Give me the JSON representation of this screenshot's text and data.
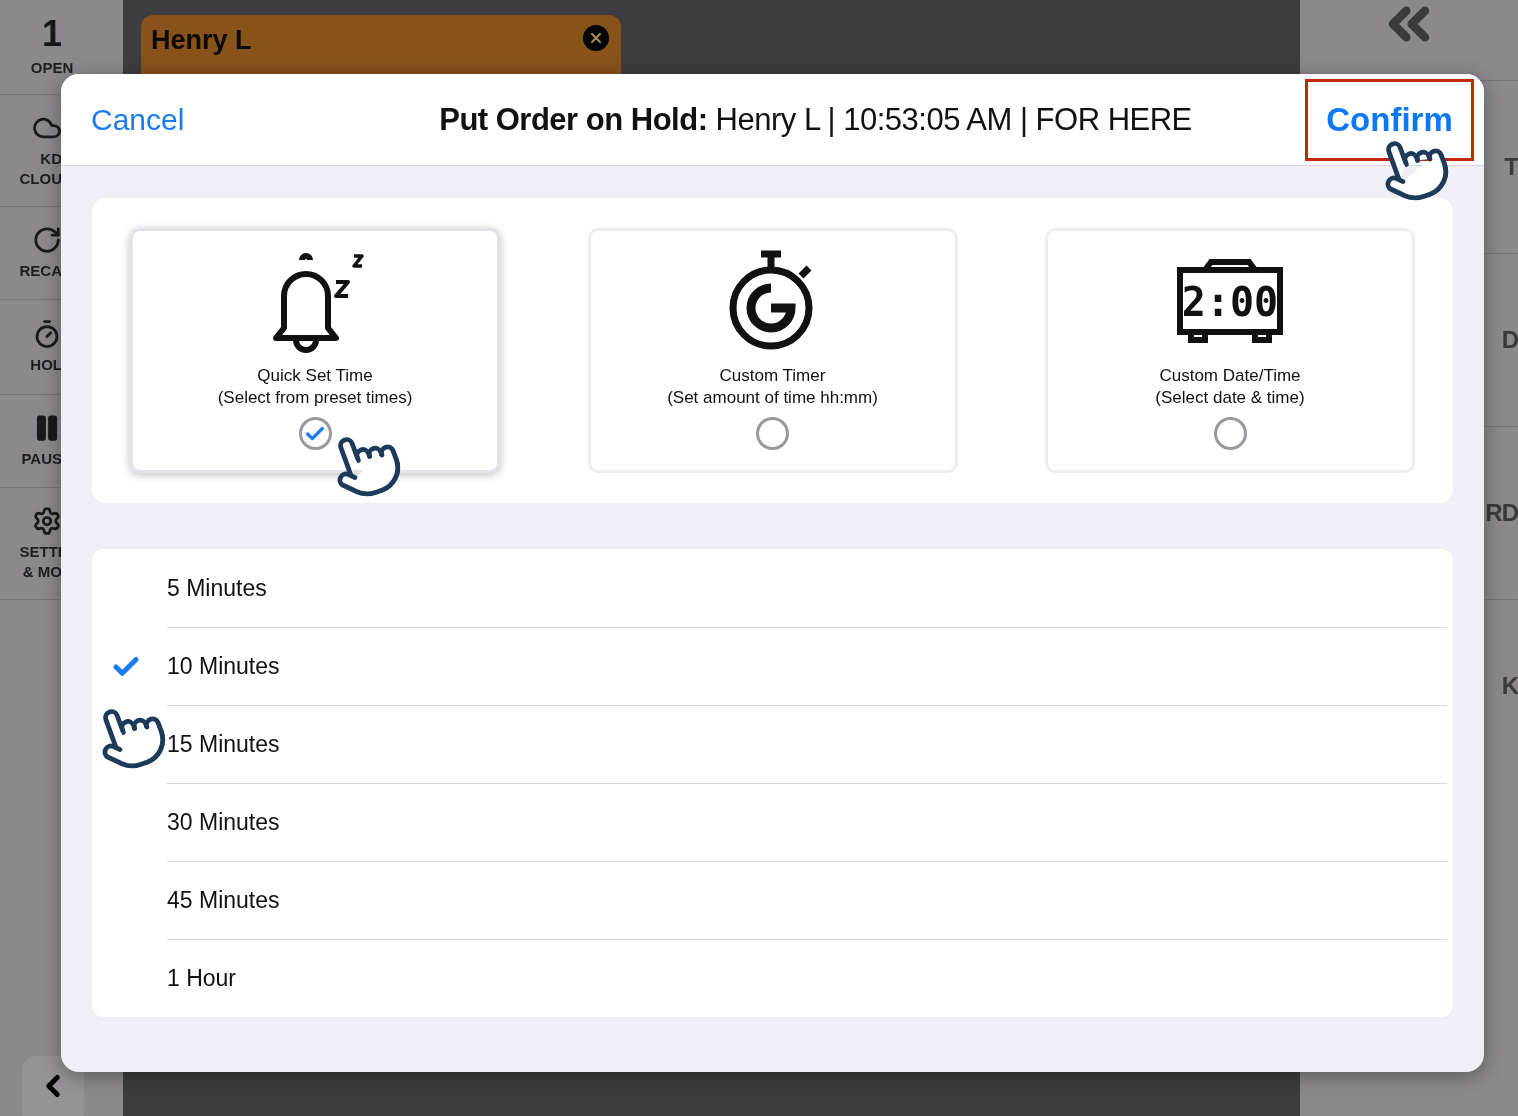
{
  "left_sidebar": {
    "items": [
      {
        "kind": "count",
        "count": "1",
        "label": "OPEN"
      },
      {
        "kind": "nav",
        "lines": [
          "KD",
          "CLOU"
        ]
      },
      {
        "kind": "nav",
        "lines": [
          "RECA"
        ]
      },
      {
        "kind": "nav",
        "lines": [
          "HOL"
        ]
      },
      {
        "kind": "nav",
        "lines": [
          "PAUS"
        ]
      },
      {
        "kind": "nav",
        "lines": [
          "SETTI",
          "& MO"
        ]
      }
    ]
  },
  "ticket": {
    "name": "Henry L"
  },
  "right_sidebar": {
    "items": [
      "T",
      "D",
      "RD",
      "K"
    ]
  },
  "dialog": {
    "cancel": "Cancel",
    "title": "**Put Order on Hold:** Henry L | 10:53:05 AM | FOR HERE",
    "confirm": {
      "label": "Confirm",
      "highlighted": true
    },
    "options": [
      {
        "kind": "bell",
        "title": "Quick Set Time",
        "subtitle": "(Select from preset times)",
        "selected": true
      },
      {
        "kind": "stopwatch",
        "title": "Custom Timer",
        "subtitle": "(Set amount of time hh:mm)",
        "selected": false
      },
      {
        "kind": "clock",
        "clock_text": "2:00",
        "title": "Custom Date/Time",
        "subtitle": "(Select date & time)",
        "selected": false
      }
    ],
    "presets": [
      {
        "label": "5 Minutes",
        "selected": false
      },
      {
        "label": "10 Minutes",
        "selected": true
      },
      {
        "label": "15 Minutes",
        "selected": false
      },
      {
        "label": "30 Minutes",
        "selected": false
      },
      {
        "label": "45 Minutes",
        "selected": false
      },
      {
        "label": "1 Hour",
        "selected": false
      }
    ]
  }
}
